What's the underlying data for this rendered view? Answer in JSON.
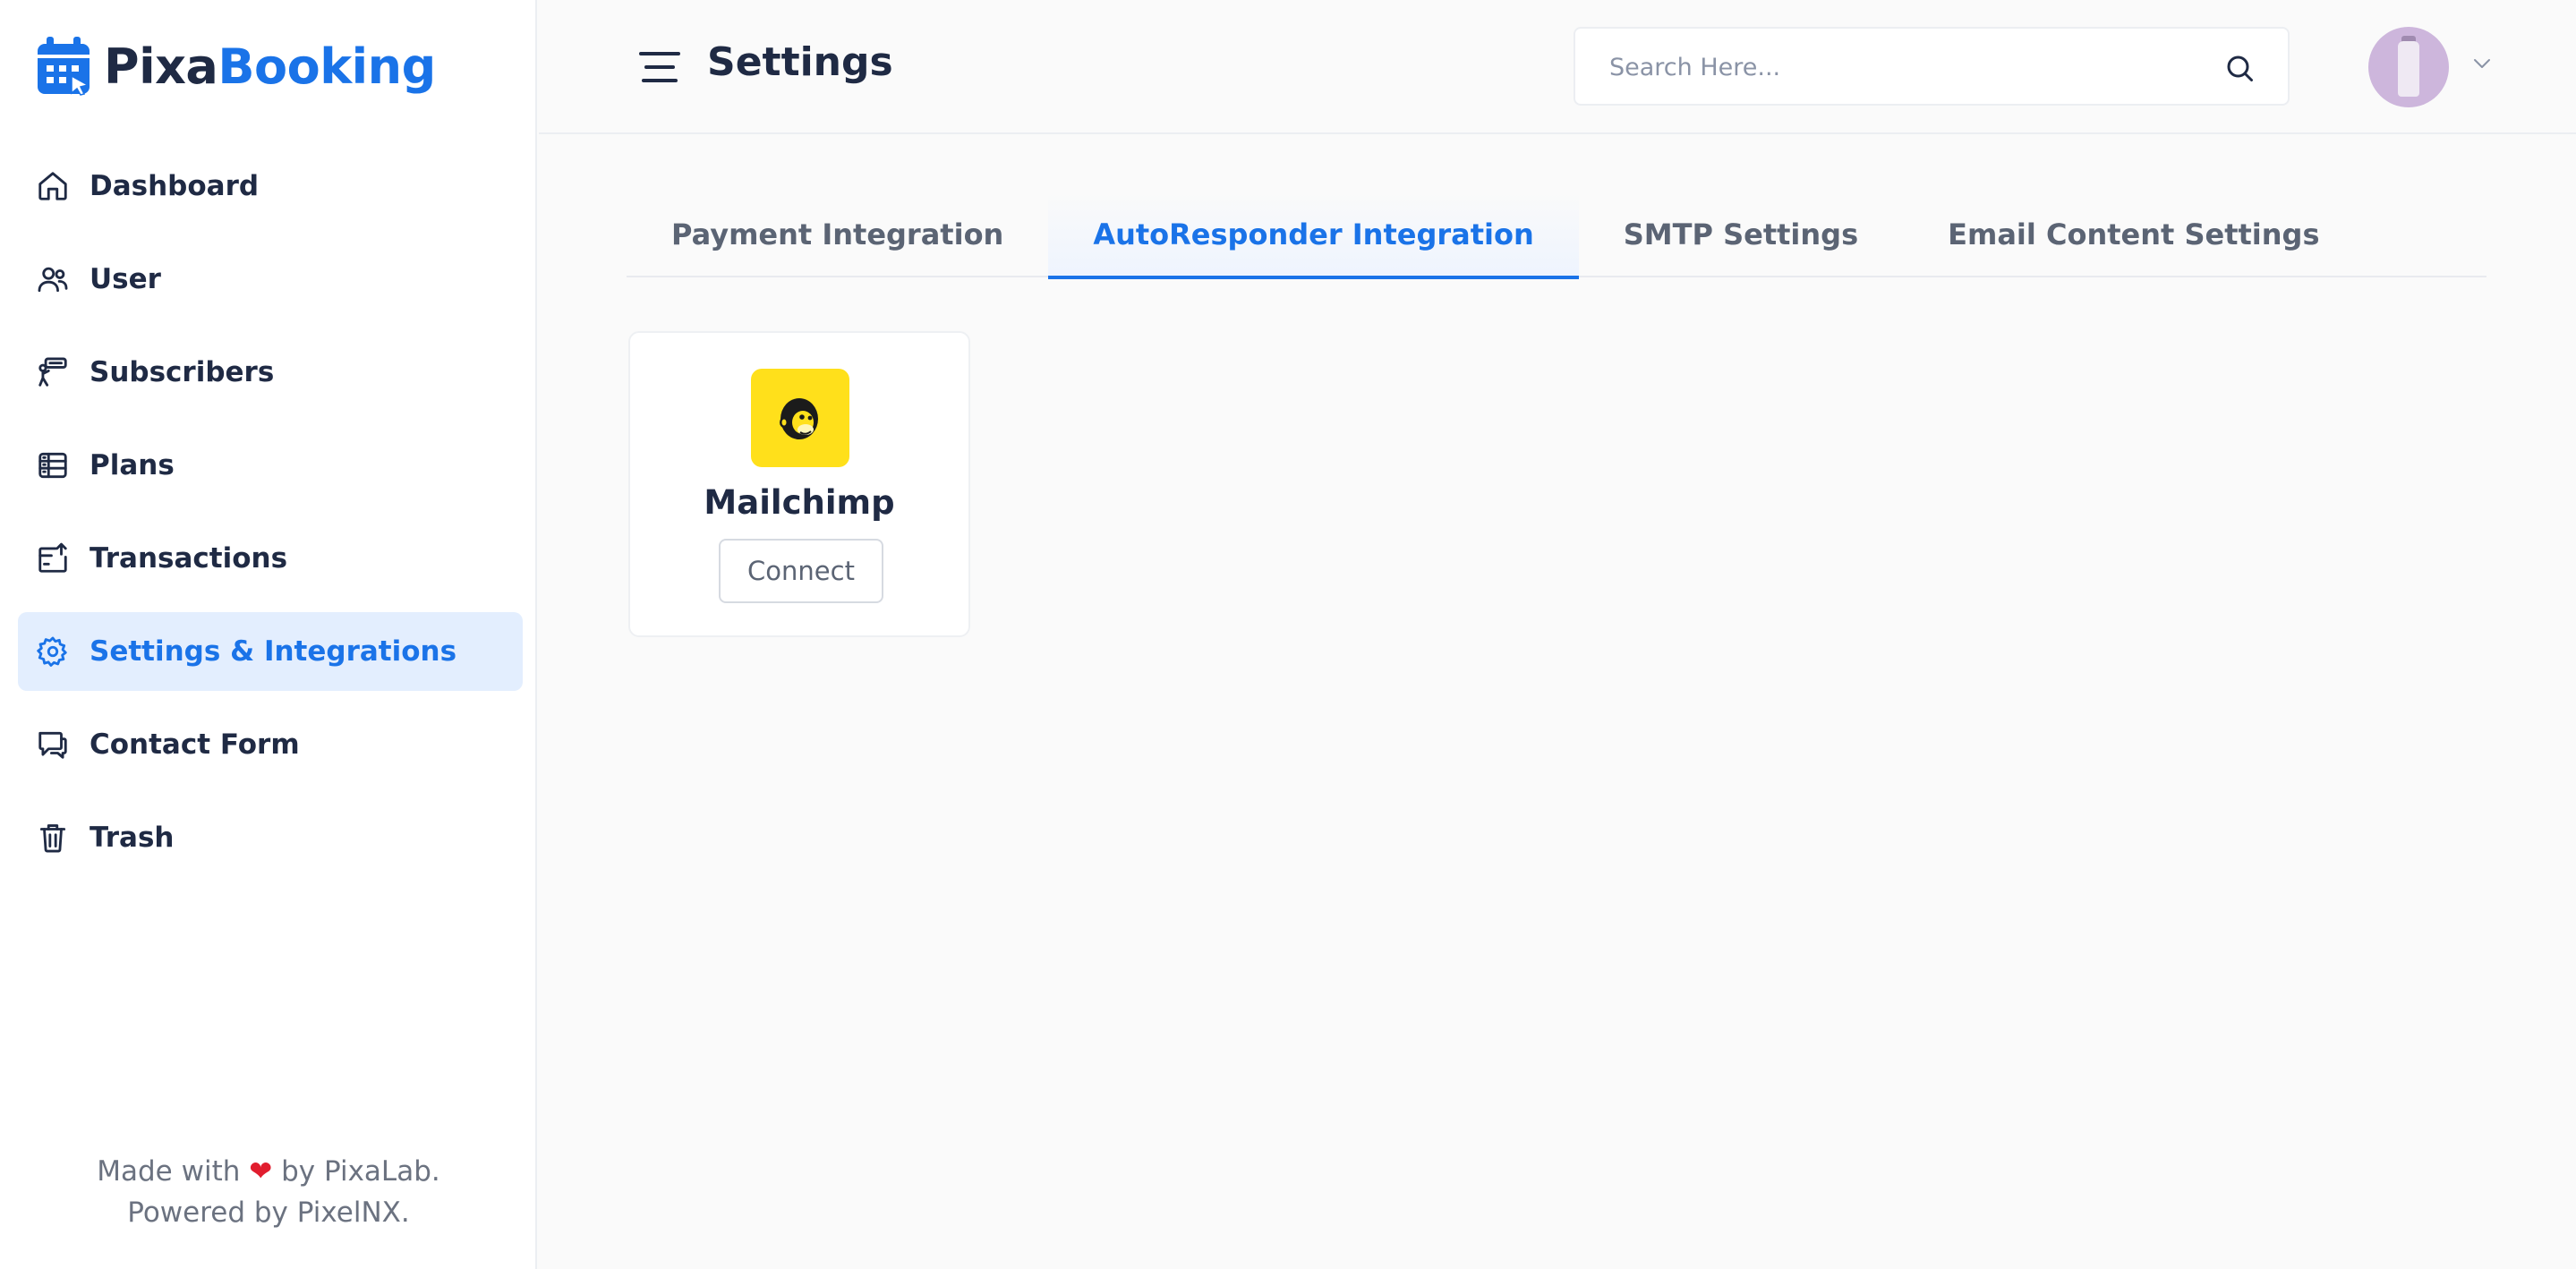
{
  "brand": {
    "part1": "Pixa",
    "part2": "Booking"
  },
  "sidebar": {
    "items": [
      {
        "label": "Dashboard",
        "icon": "home-icon"
      },
      {
        "label": "User",
        "icon": "users-icon"
      },
      {
        "label": "Subscribers",
        "icon": "subscribers-icon"
      },
      {
        "label": "Plans",
        "icon": "plans-icon"
      },
      {
        "label": "Transactions",
        "icon": "transactions-icon"
      },
      {
        "label": "Settings & Integrations",
        "icon": "gear-icon"
      },
      {
        "label": "Contact Form",
        "icon": "chat-icon"
      },
      {
        "label": "Trash",
        "icon": "trash-icon"
      }
    ],
    "active_index": 5,
    "footer": {
      "made_prefix": "Made with",
      "heart": "❤",
      "made_suffix": "by PixaLab.",
      "powered": "Powered by PixelNX."
    }
  },
  "header": {
    "title": "Settings",
    "search_placeholder": "Search Here..."
  },
  "tabs": [
    {
      "label": "Payment Integration",
      "active": false
    },
    {
      "label": "AutoResponder Integration",
      "active": true
    },
    {
      "label": "SMTP Settings",
      "active": false
    },
    {
      "label": "Email Content Settings",
      "active": false
    }
  ],
  "integrations": [
    {
      "name": "Mailchimp",
      "button": "Connect",
      "icon": "mailchimp-icon"
    }
  ],
  "colors": {
    "accent": "#1a73e8",
    "text": "#1f2a44",
    "active_bg": "#e3eefe",
    "mailchimp_yellow": "#ffe01b"
  }
}
